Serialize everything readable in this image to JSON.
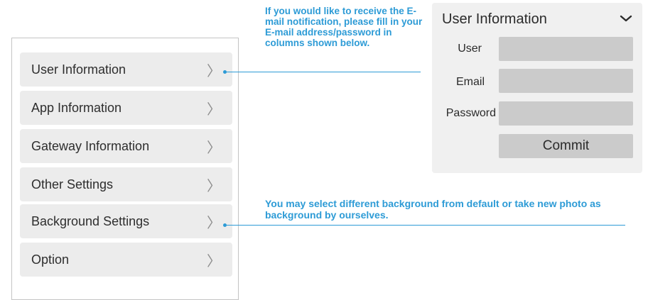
{
  "menu": {
    "items": [
      {
        "label": "User Information"
      },
      {
        "label": "App Information"
      },
      {
        "label": "Gateway Information"
      },
      {
        "label": "Other Settings"
      },
      {
        "label": "Background Settings"
      },
      {
        "label": "Option"
      }
    ],
    "chevron_glyph": "〉"
  },
  "callouts": {
    "email_note": "If you would like to receive the E-mail notification, please fill in your E-mail address/password in columns shown below.",
    "background_note": "You may select different background from default or take new photo as background by ourselves."
  },
  "user_form": {
    "title": "User Information",
    "fields": [
      {
        "label": "User",
        "value": "",
        "placeholder": ""
      },
      {
        "label": "Email",
        "value": "",
        "placeholder": ""
      },
      {
        "label": "Password",
        "value": "",
        "placeholder": ""
      }
    ],
    "commit_label": "Commit"
  },
  "colors": {
    "accent": "#2d9bd6",
    "menu_item_bg": "#ececec",
    "form_bg": "#f0f0f0",
    "input_bg": "#cbcbcb"
  },
  "icons": {
    "menu_arrow": "chevron-right-icon",
    "form_collapse": "chevron-down-icon"
  }
}
